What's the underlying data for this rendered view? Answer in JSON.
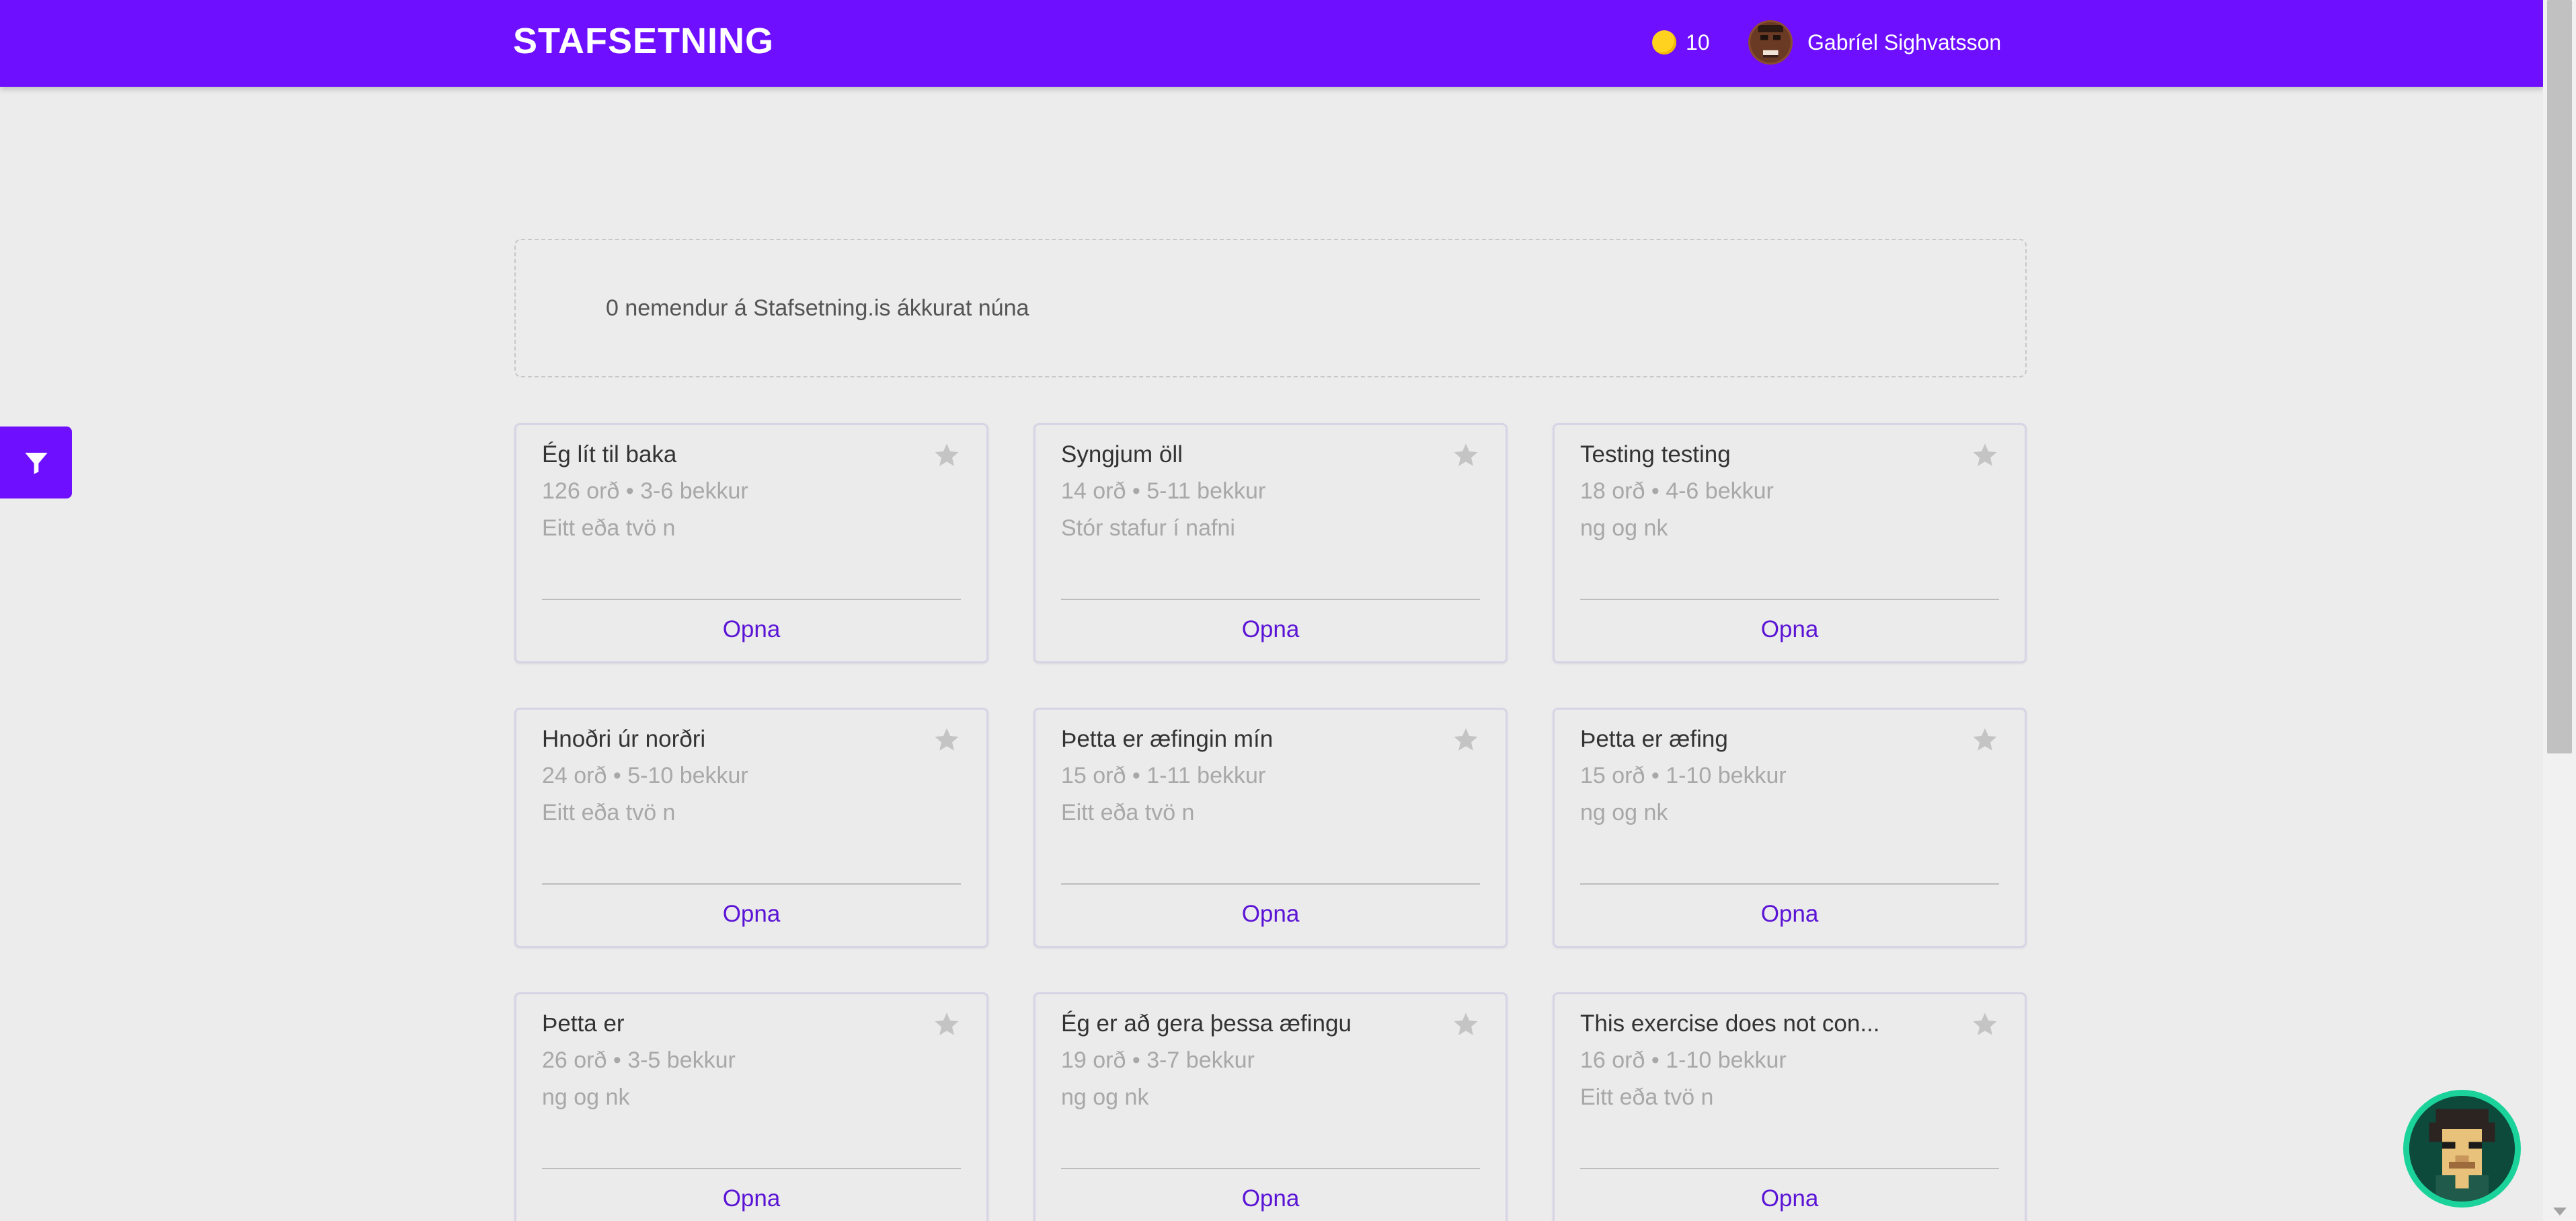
{
  "header": {
    "brand": "STAFSETNING",
    "coins": "10",
    "user_name": "Gabríel Sighvatsson"
  },
  "online": {
    "text": "0 nemendur á Stafsetning.is ákkurat núna"
  },
  "cards": [
    {
      "title": "Ég lít til baka",
      "meta": "126 orð • 3-6 bekkur",
      "category": "Eitt eða tvö n",
      "open": "Opna"
    },
    {
      "title": "Syngjum öll",
      "meta": "14 orð • 5-11 bekkur",
      "category": "Stór stafur í nafni",
      "open": "Opna"
    },
    {
      "title": "Testing testing",
      "meta": "18 orð • 4-6 bekkur",
      "category": "ng og nk",
      "open": "Opna"
    },
    {
      "title": "Hnoðri úr norðri",
      "meta": "24 orð • 5-10 bekkur",
      "category": "Eitt eða tvö n",
      "open": "Opna"
    },
    {
      "title": "Þetta er æfingin mín",
      "meta": "15 orð • 1-11 bekkur",
      "category": "Eitt eða tvö n",
      "open": "Opna"
    },
    {
      "title": "Þetta er æfing",
      "meta": "15 orð • 1-10 bekkur",
      "category": "ng og nk",
      "open": "Opna"
    },
    {
      "title": "Þetta er",
      "meta": "26 orð • 3-5 bekkur",
      "category": "ng og nk",
      "open": "Opna"
    },
    {
      "title": "Ég er að gera þessa æfingu",
      "meta": "19 orð • 3-7 bekkur",
      "category": "ng og nk",
      "open": "Opna"
    },
    {
      "title": "This exercise does not con...",
      "meta": "16 orð • 1-10 bekkur",
      "category": "Eitt eða tvö n",
      "open": "Opna"
    }
  ],
  "icons": {
    "filter": "filter-icon",
    "star": "star-icon",
    "coin": "coin-icon"
  },
  "colors": {
    "brand": "#6e0fff",
    "link": "#5b14d6",
    "coin": "#ffd21f",
    "star": "#c4c4c4"
  }
}
